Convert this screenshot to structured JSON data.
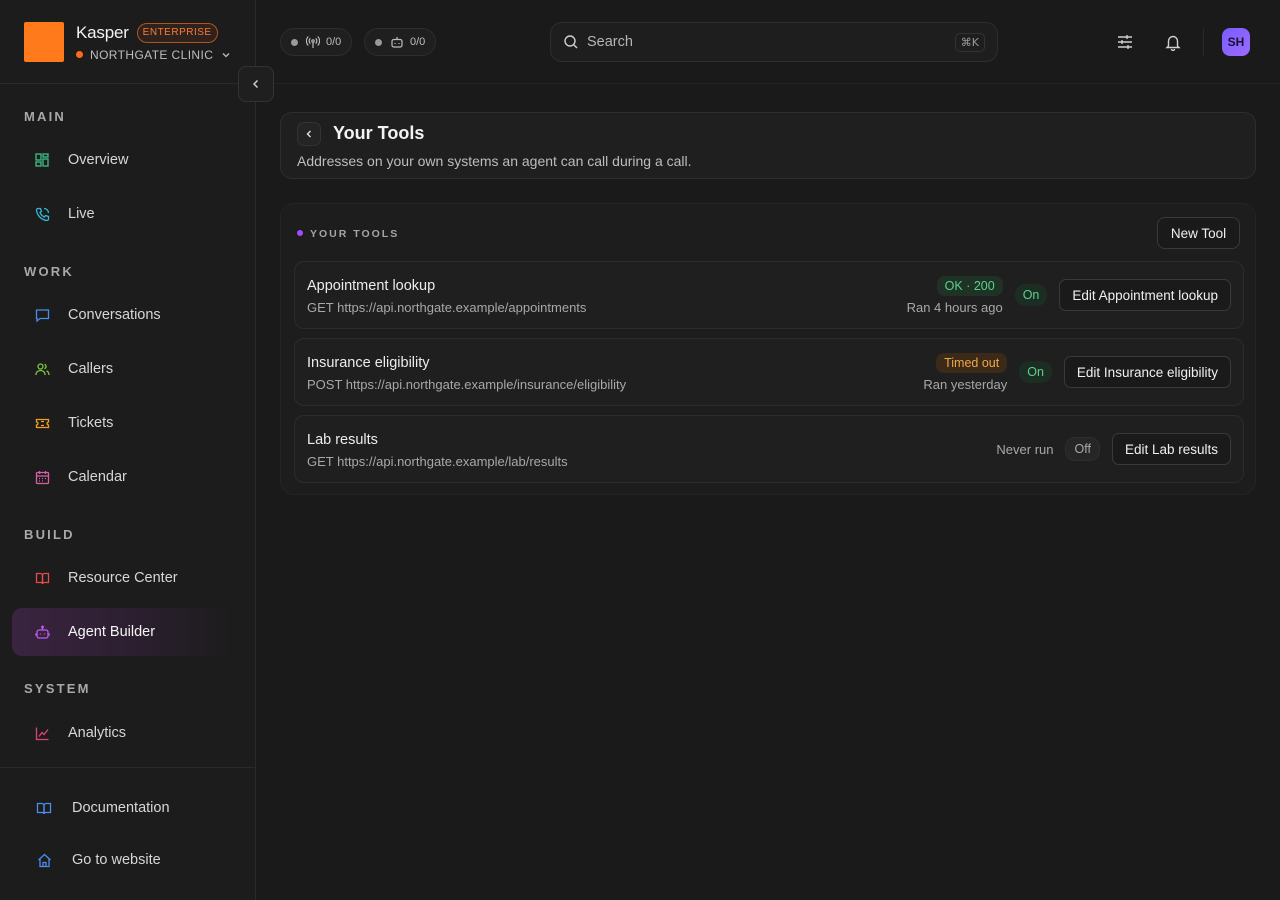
{
  "brand": {
    "name": "Kasper",
    "plan_badge": "ENTERPRISE",
    "org": "NORTHGATE CLINIC",
    "logo_color": "#ff7a1a"
  },
  "topbar": {
    "status_calls": "0/0",
    "status_agents": "0/0",
    "search": {
      "placeholder": "Search",
      "shortcut": "⌘K"
    },
    "avatar_initials": "SH"
  },
  "sidebar": {
    "sections": [
      {
        "label": "MAIN",
        "items": [
          {
            "label": "Overview",
            "icon": "grid-icon"
          },
          {
            "label": "Live",
            "icon": "phone-icon"
          }
        ]
      },
      {
        "label": "WORK",
        "items": [
          {
            "label": "Conversations",
            "icon": "chat-icon"
          },
          {
            "label": "Callers",
            "icon": "users-icon"
          },
          {
            "label": "Tickets",
            "icon": "ticket-icon"
          },
          {
            "label": "Calendar",
            "icon": "calendar-icon"
          }
        ]
      },
      {
        "label": "BUILD",
        "items": [
          {
            "label": "Resource Center",
            "icon": "book-icon"
          },
          {
            "label": "Agent Builder",
            "icon": "bot-icon",
            "active": true
          }
        ]
      },
      {
        "label": "SYSTEM",
        "items": [
          {
            "label": "Analytics",
            "icon": "chart-icon"
          }
        ]
      }
    ],
    "footer": [
      {
        "label": "Documentation",
        "icon": "book-open-icon"
      },
      {
        "label": "Go to website",
        "icon": "home-icon"
      }
    ]
  },
  "page": {
    "title": "Your Tools",
    "subtitle": "Addresses on your own systems an agent can call during a call."
  },
  "tools_panel": {
    "heading": "YOUR TOOLS",
    "new_button": "New Tool",
    "tools": [
      {
        "name": "Appointment lookup",
        "url": "GET https://api.northgate.example/appointments",
        "status": "OK · 200",
        "status_kind": "ok",
        "ran": "Ran 4 hours ago",
        "toggle": "On",
        "edit": "Edit Appointment lookup"
      },
      {
        "name": "Insurance eligibility",
        "url": "POST https://api.northgate.example/insurance/eligibility",
        "status": "Timed out",
        "status_kind": "warn",
        "ran": "Ran yesterday",
        "toggle": "On",
        "edit": "Edit Insurance eligibility"
      },
      {
        "name": "Lab results",
        "url": "GET https://api.northgate.example/lab/results",
        "status": "",
        "ran": "Never run",
        "toggle": "Off",
        "edit": "Edit Lab results"
      }
    ]
  }
}
